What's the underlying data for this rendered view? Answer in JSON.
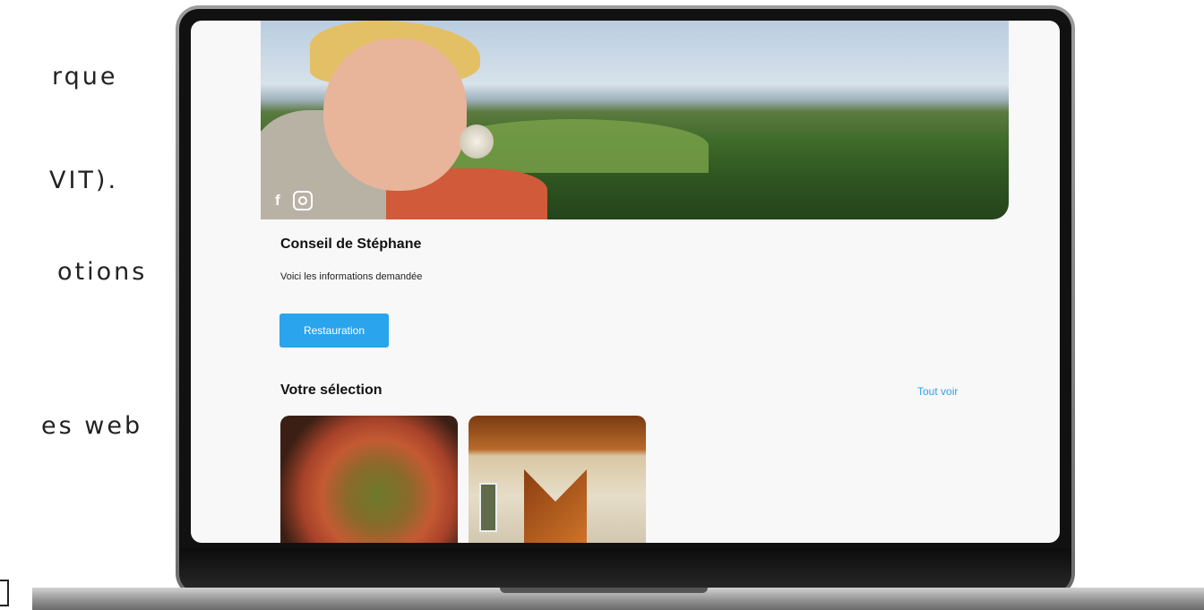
{
  "side_text": {
    "line1": "rque",
    "line2": "VIT).",
    "line3": "otions",
    "line4": "es web"
  },
  "page": {
    "title": "Conseil de Stéphane",
    "subtitle": "Voici les informations demandée",
    "category_button": "Restauration",
    "section_title": "Votre sélection",
    "see_all": "Tout voir"
  },
  "social": {
    "facebook": "f",
    "instagram_icon": "instagram-icon"
  },
  "colors": {
    "accent": "#2aa4ec",
    "background": "#f8f8f8"
  }
}
